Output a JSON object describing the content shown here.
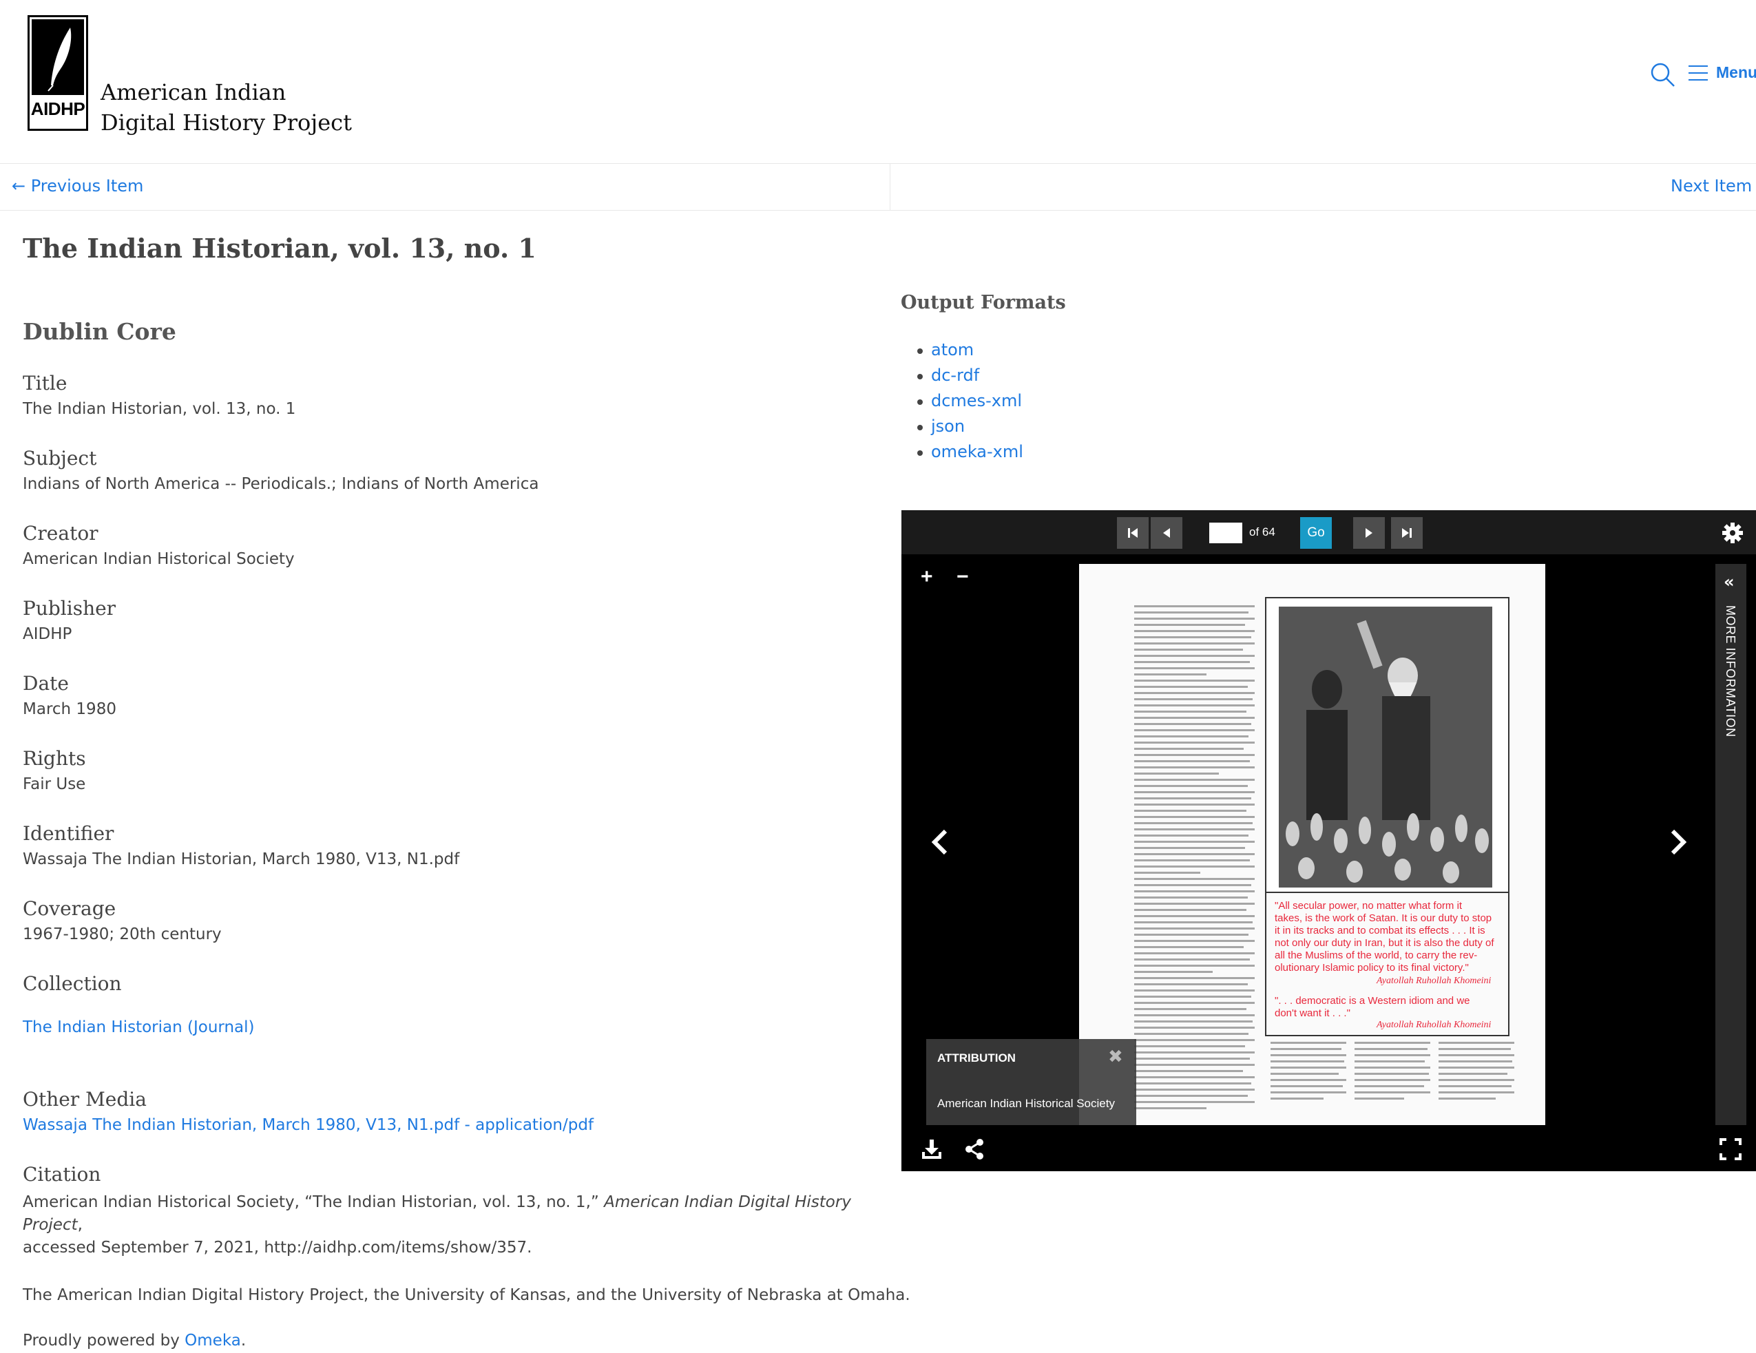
{
  "header": {
    "logo_text": "AIDHP",
    "site_title_line1": "American Indian",
    "site_title_line2": "Digital History Project",
    "menu_label": "Menu"
  },
  "item_nav": {
    "previous": "← Previous Item",
    "next": "Next Item →"
  },
  "page_title": "The Indian Historian, vol. 13, no. 1",
  "dublin_core": {
    "heading": "Dublin Core",
    "fields": [
      {
        "label": "Title",
        "value": "The Indian Historian, vol. 13, no. 1"
      },
      {
        "label": "Subject",
        "value": "Indians of North America -- Periodicals.; Indians of North America"
      },
      {
        "label": "Creator",
        "value": "American Indian Historical Society"
      },
      {
        "label": "Publisher",
        "value": "AIDHP"
      },
      {
        "label": "Date",
        "value": "March 1980"
      },
      {
        "label": "Rights",
        "value": "Fair Use"
      },
      {
        "label": "Identifier",
        "value": "Wassaja The Indian Historian, March 1980, V13, N1.pdf"
      },
      {
        "label": "Coverage",
        "value": "1967-1980; 20th century"
      }
    ]
  },
  "collection": {
    "label": "Collection",
    "link": "The Indian Historian (Journal)"
  },
  "other_media": {
    "label": "Other Media",
    "link": "Wassaja The Indian Historian, March 1980, V13, N1.pdf - application/pdf"
  },
  "citation": {
    "label": "Citation",
    "text_before": "American Indian Historical Society, “The Indian Historian, vol. 13, no. 1,” ",
    "text_italic": "American Indian Digital History Project",
    "text_after": ",",
    "line2": "accessed September 7, 2021, http://aidhp.com/items/show/357."
  },
  "footer": {
    "credits": "The American Indian Digital History Project, the University of Kansas, and the University of Nebraska at Omaha.",
    "powered_prefix": "Proudly powered by ",
    "powered_link": "Omeka",
    "powered_suffix": "."
  },
  "output_formats": {
    "heading": "Output Formats",
    "items": [
      "atom",
      "dc-rdf",
      "dcmes-xml",
      "json",
      "omeka-xml"
    ]
  },
  "viewer": {
    "page_value": "",
    "page_of": "of 64",
    "go_label": "Go",
    "zoom_in": "+",
    "zoom_out": "−",
    "more_info_label": "MORE INFORMATION",
    "attribution_title": "ATTRIBUTION",
    "attribution_text": "American Indian Historical Society",
    "quote1_lines": [
      "\"All secular power, no matter what form it",
      "takes, is the work of Satan. It is our duty to stop",
      "it in its tracks and to combat its effects . . . It is",
      "not only our duty in Iran, but it is also the duty of",
      "all the Muslims of the world, to carry the rev-",
      "olutionary Islamic policy to its final victory.\""
    ],
    "quote_signature": "Ayatollah Ruhollah Khomeini",
    "quote2_lines": [
      "\". . . democratic is a Western idiom and we",
      "don't want it . . .\""
    ],
    "accent_color": "#1a9bc7",
    "quote_color": "#e8283c"
  },
  "colors": {
    "link": "#1f7ae0",
    "viewer_bg": "#000000"
  }
}
